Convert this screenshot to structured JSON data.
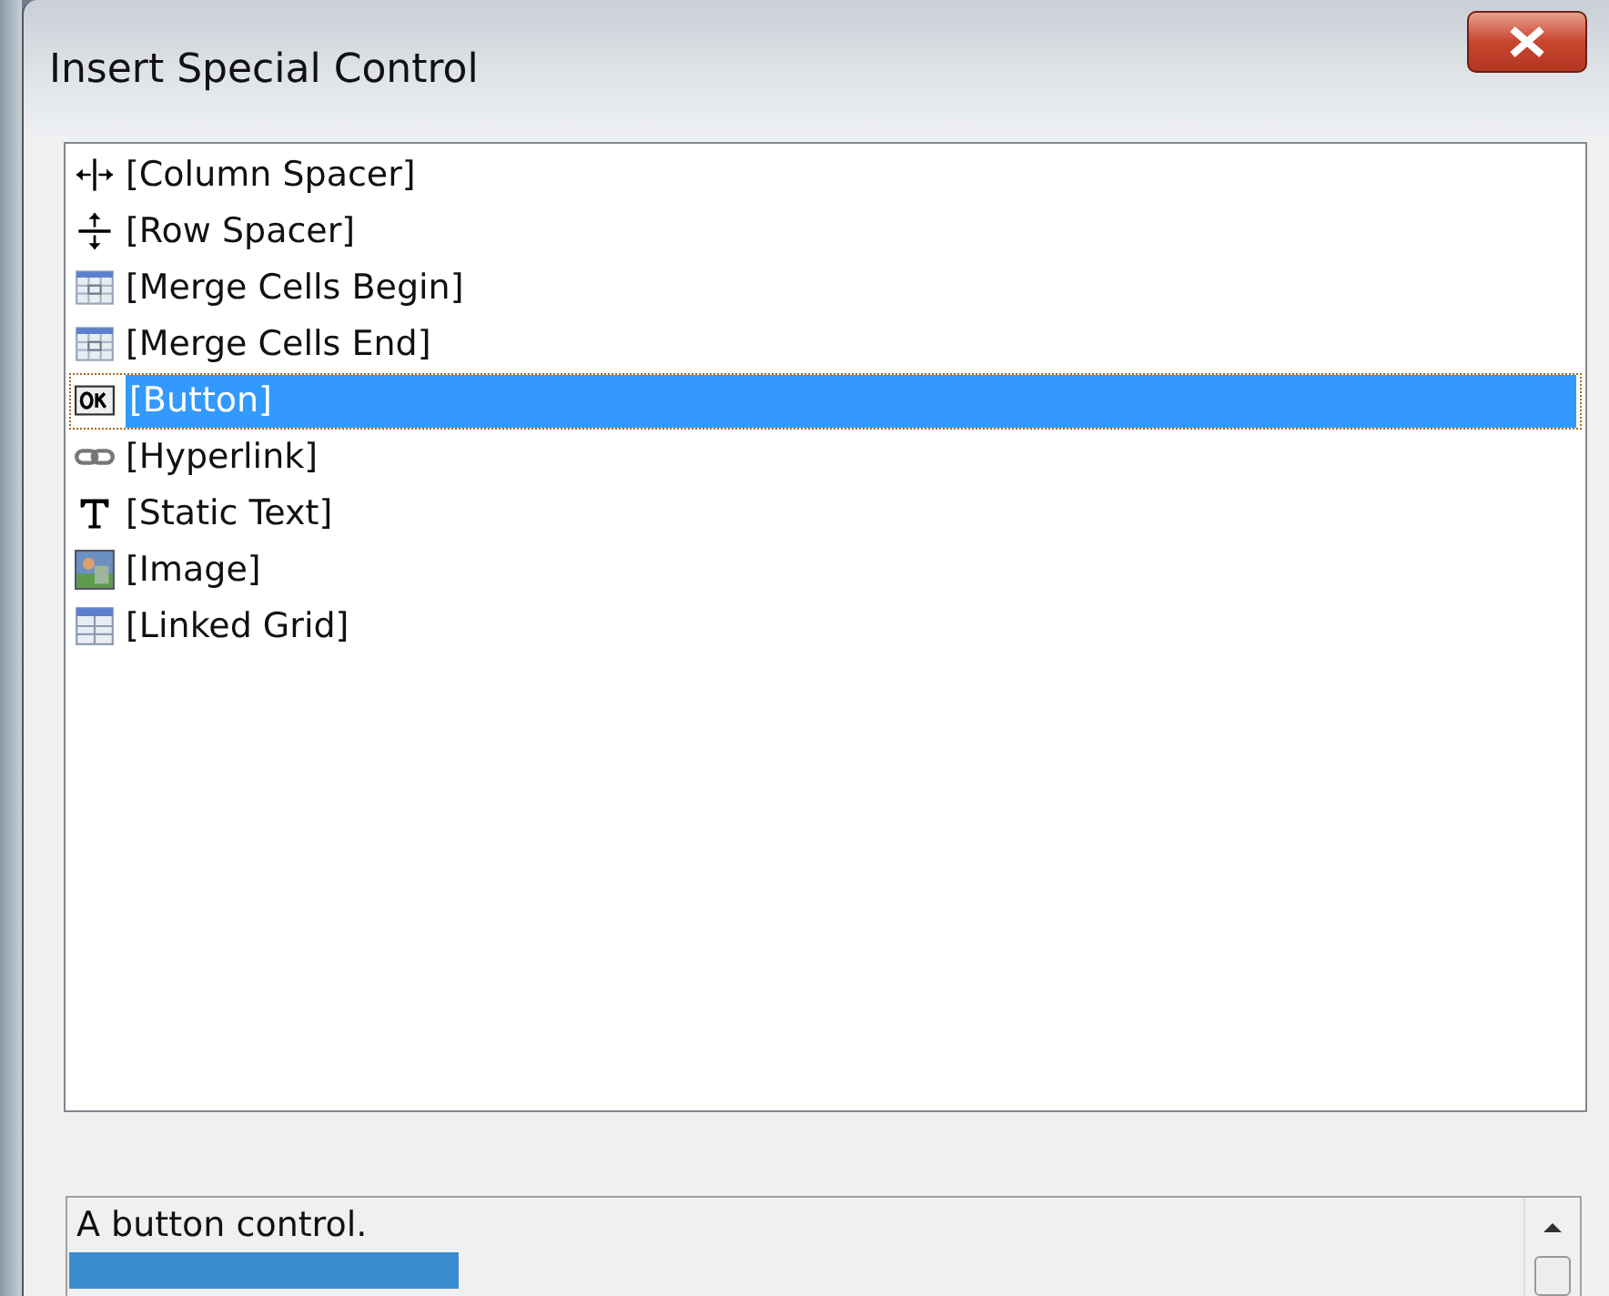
{
  "window": {
    "title": "Insert Special Control"
  },
  "controls": [
    {
      "label": "[Column Spacer]",
      "kind": "spacer",
      "selected": false
    },
    {
      "label": "[Row Spacer]",
      "kind": "spacer",
      "selected": false
    },
    {
      "label": "[Merge Cells Begin]",
      "kind": "merge",
      "selected": false
    },
    {
      "label": "[Merge Cells End]",
      "kind": "merge",
      "selected": false
    },
    {
      "label": "[Button]",
      "kind": "button",
      "selected": true
    },
    {
      "label": "[Hyperlink]",
      "kind": "hyperlink",
      "selected": false
    },
    {
      "label": "[Static Text]",
      "kind": "text",
      "selected": false
    },
    {
      "label": "[Image]",
      "kind": "image",
      "selected": false
    },
    {
      "label": "[Linked Grid]",
      "kind": "grid",
      "selected": false
    }
  ],
  "description": {
    "text": "A button control."
  }
}
